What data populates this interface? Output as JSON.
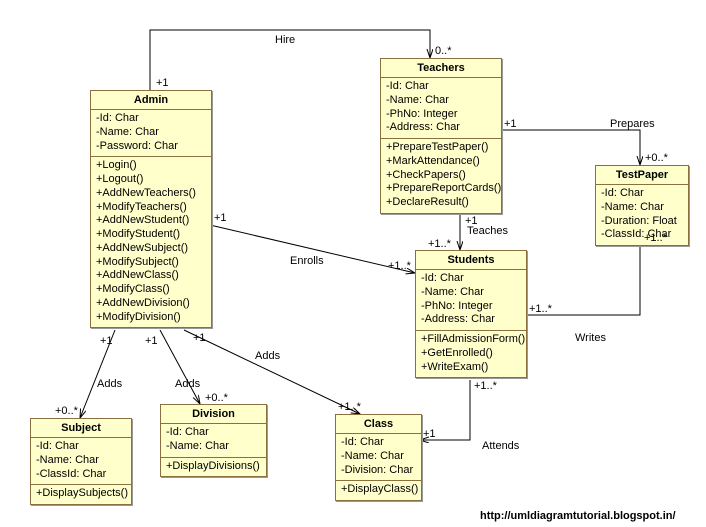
{
  "attribution": "http://umldiagramtutorial.blogspot.in/",
  "relationships": {
    "hire": {
      "label": "Hire",
      "admin_end": "+1",
      "teachers_end": "0..*"
    },
    "prepares": {
      "label": "Prepares",
      "teachers_end": "+1",
      "testpaper_end": "+0..*"
    },
    "teaches": {
      "label": "Teaches",
      "teachers_end": "+1",
      "students_end": "+1..*"
    },
    "enrolls": {
      "label": "Enrolls",
      "admin_end": "+1",
      "students_end": "+1..*"
    },
    "writes": {
      "label": "Writes",
      "students_end": "+1..*",
      "testpaper_end": "+1..*"
    },
    "attends": {
      "label": "Attends",
      "students_end": "+1..*",
      "class_end": "+1"
    },
    "adds_subject": {
      "label": "Adds",
      "admin_end": "+1",
      "subject_end": "+0..*"
    },
    "adds_division": {
      "label": "Adds",
      "admin_end": "+1",
      "division_end": "+0..*"
    },
    "adds_class": {
      "label": "Adds",
      "admin_end": "+1",
      "class_end": "+1..*"
    }
  },
  "classes": {
    "admin": {
      "name": "Admin",
      "attrs": [
        "-Id: Char",
        "-Name: Char",
        "-Password: Char"
      ],
      "ops": [
        "+Login()",
        "+Logout()",
        "+AddNewTeachers()",
        "+ModifyTeachers()",
        "+AddNewStudent()",
        "+ModifyStudent()",
        "+AddNewSubject()",
        "+ModifySubject()",
        "+AddNewClass()",
        "+ModifyClass()",
        "+AddNewDivision()",
        "+ModifyDivision()"
      ]
    },
    "teachers": {
      "name": "Teachers",
      "attrs": [
        "-Id: Char",
        "-Name: Char",
        "-PhNo: Integer",
        "-Address: Char"
      ],
      "ops": [
        "+PrepareTestPaper()",
        "+MarkAttendance()",
        "+CheckPapers()",
        "+PrepareReportCards()",
        "+DeclareResult()"
      ]
    },
    "testpaper": {
      "name": "TestPaper",
      "attrs": [
        "-Id: Char",
        "-Name: Char",
        "-Duration: Float",
        "-ClassId: Char"
      ],
      "ops": []
    },
    "students": {
      "name": "Students",
      "attrs": [
        "-Id: Char",
        "-Name: Char",
        "-PhNo: Integer",
        "-Address: Char"
      ],
      "ops": [
        "+FillAdmissionForm()",
        "+GetEnrolled()",
        "+WriteExam()"
      ]
    },
    "subject": {
      "name": "Subject",
      "attrs": [
        "-Id: Char",
        "-Name: Char",
        "-ClassId: Char"
      ],
      "ops": [
        "+DisplaySubjects()"
      ]
    },
    "division": {
      "name": "Division",
      "attrs": [
        "-Id: Char",
        "-Name: Char"
      ],
      "ops": [
        "+DisplayDivisions()"
      ]
    },
    "class": {
      "name": "Class",
      "attrs": [
        "-Id: Char",
        "-Name: Char",
        "-Division: Char"
      ],
      "ops": [
        "+DisplayClass()"
      ]
    }
  }
}
